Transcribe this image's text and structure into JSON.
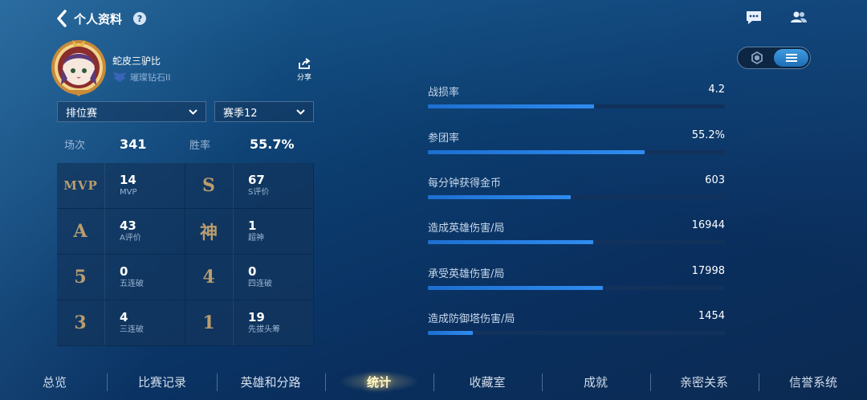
{
  "header": {
    "title": "个人资料",
    "help": "?"
  },
  "profile": {
    "name": "蛇皮三驴比",
    "rank": "璀璨钻石II",
    "share_label": "分享"
  },
  "filters": {
    "mode": "排位赛",
    "season": "赛季12"
  },
  "summary": {
    "matches_label": "场次",
    "matches_value": "341",
    "winrate_label": "胜率",
    "winrate_value": "55.7%"
  },
  "achievements": [
    {
      "badge": "MVP",
      "value": "14",
      "label": "MVP"
    },
    {
      "badge": "S",
      "value": "67",
      "label": "S评价"
    },
    {
      "badge": "A",
      "value": "43",
      "label": "A评价"
    },
    {
      "badge": "神",
      "value": "1",
      "label": "超神"
    },
    {
      "badge": "5",
      "value": "0",
      "label": "五连破"
    },
    {
      "badge": "4",
      "value": "0",
      "label": "四连破"
    },
    {
      "badge": "3",
      "value": "4",
      "label": "三连破"
    },
    {
      "badge": "1",
      "value": "19",
      "label": "先拔头筹"
    }
  ],
  "stats": [
    {
      "label": "战损率",
      "value": "4.2",
      "fill": 0.56
    },
    {
      "label": "参团率",
      "value": "55.2%",
      "fill": 0.73
    },
    {
      "label": "每分钟获得金币",
      "value": "603",
      "fill": 0.48
    },
    {
      "label": "造成英雄伤害/局",
      "value": "16944",
      "fill": 0.556
    },
    {
      "label": "承受英雄伤害/局",
      "value": "17998",
      "fill": 0.59
    },
    {
      "label": "造成防御塔伤害/局",
      "value": "1454",
      "fill": 0.15
    }
  ],
  "nav": [
    "总览",
    "比赛记录",
    "英雄和分路",
    "统计",
    "收藏室",
    "成就",
    "亲密关系",
    "信誉系统"
  ],
  "nav_active_index": 3,
  "colors": {
    "bar_fill": "#2f8cf0",
    "bar_track": "#12325b",
    "badge_gold": "#b99c6e",
    "active_tab": "#fff6cc"
  }
}
